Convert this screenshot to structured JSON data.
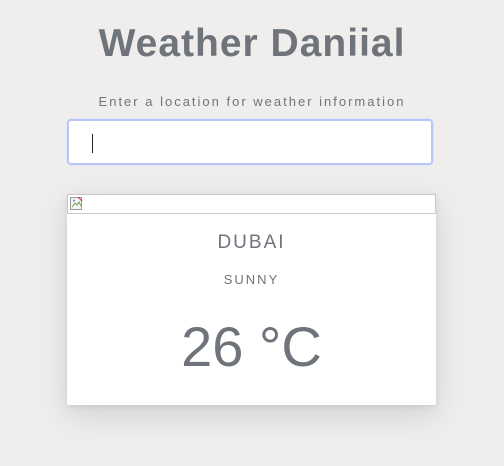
{
  "app": {
    "title": "Weather Daniial",
    "subtitle": "Enter a location for weather information"
  },
  "search": {
    "value": "",
    "placeholder": ""
  },
  "weather": {
    "city": "DUBAI",
    "condition": "SUNNY",
    "temperature": "26 °C",
    "icon": "broken-image-icon"
  },
  "colors": {
    "background": "#efeeec",
    "text": "#6f747b",
    "input_focus_border": "#b7c6f3",
    "card_background": "#ffffff"
  }
}
